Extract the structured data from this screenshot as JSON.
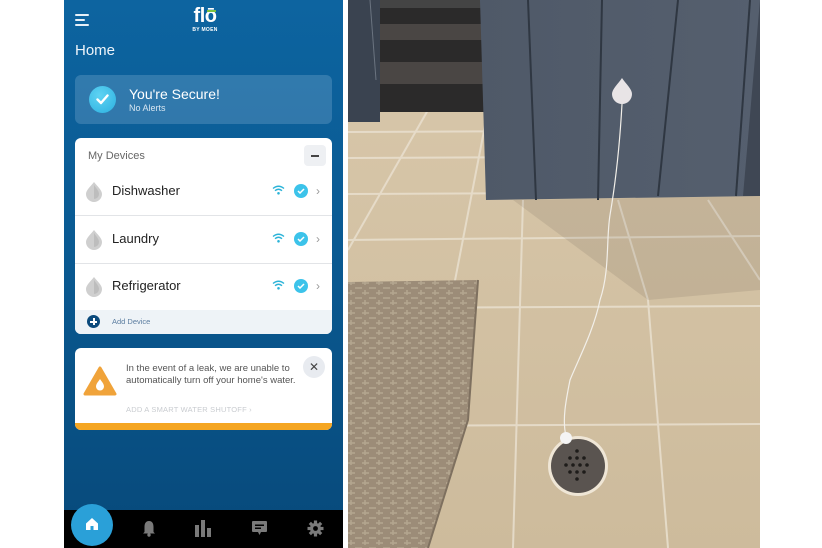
{
  "app": {
    "logo_text": "flō",
    "logo_sub": "BY MOEN",
    "page_title": "Home"
  },
  "status": {
    "title": "You're Secure!",
    "subtitle": "No Alerts"
  },
  "devices": {
    "header": "My Devices",
    "items": [
      {
        "name": "Dishwasher",
        "wifi": "connected",
        "status": "ok"
      },
      {
        "name": "Laundry",
        "wifi": "connected",
        "status": "ok"
      },
      {
        "name": "Refrigerator",
        "wifi": "connected",
        "status": "ok"
      }
    ],
    "add_label": "Add Device"
  },
  "alert": {
    "message": "In the event of a leak, we are unable to automatically turn off your home's water.",
    "link": "ADD A SMART WATER SHUTOFF ›",
    "close": "✕"
  },
  "nav": {
    "items": [
      {
        "icon": "home-icon",
        "active": true
      },
      {
        "icon": "bell-icon",
        "active": false
      },
      {
        "icon": "bar-chart-icon",
        "active": false
      },
      {
        "icon": "message-icon",
        "active": false
      },
      {
        "icon": "gear-icon",
        "active": false
      }
    ]
  },
  "colors": {
    "brand_blue": "#0d64a0",
    "accent_cyan": "#3cc3ea",
    "warning_orange": "#f5a623",
    "nav_active": "#2aa0d8"
  },
  "photo": {
    "description": "Flo water leak sensor mounted on dark gray paneled wall with cable running to floor drain on beige tile floor, carpeted stairs and doormat visible"
  }
}
